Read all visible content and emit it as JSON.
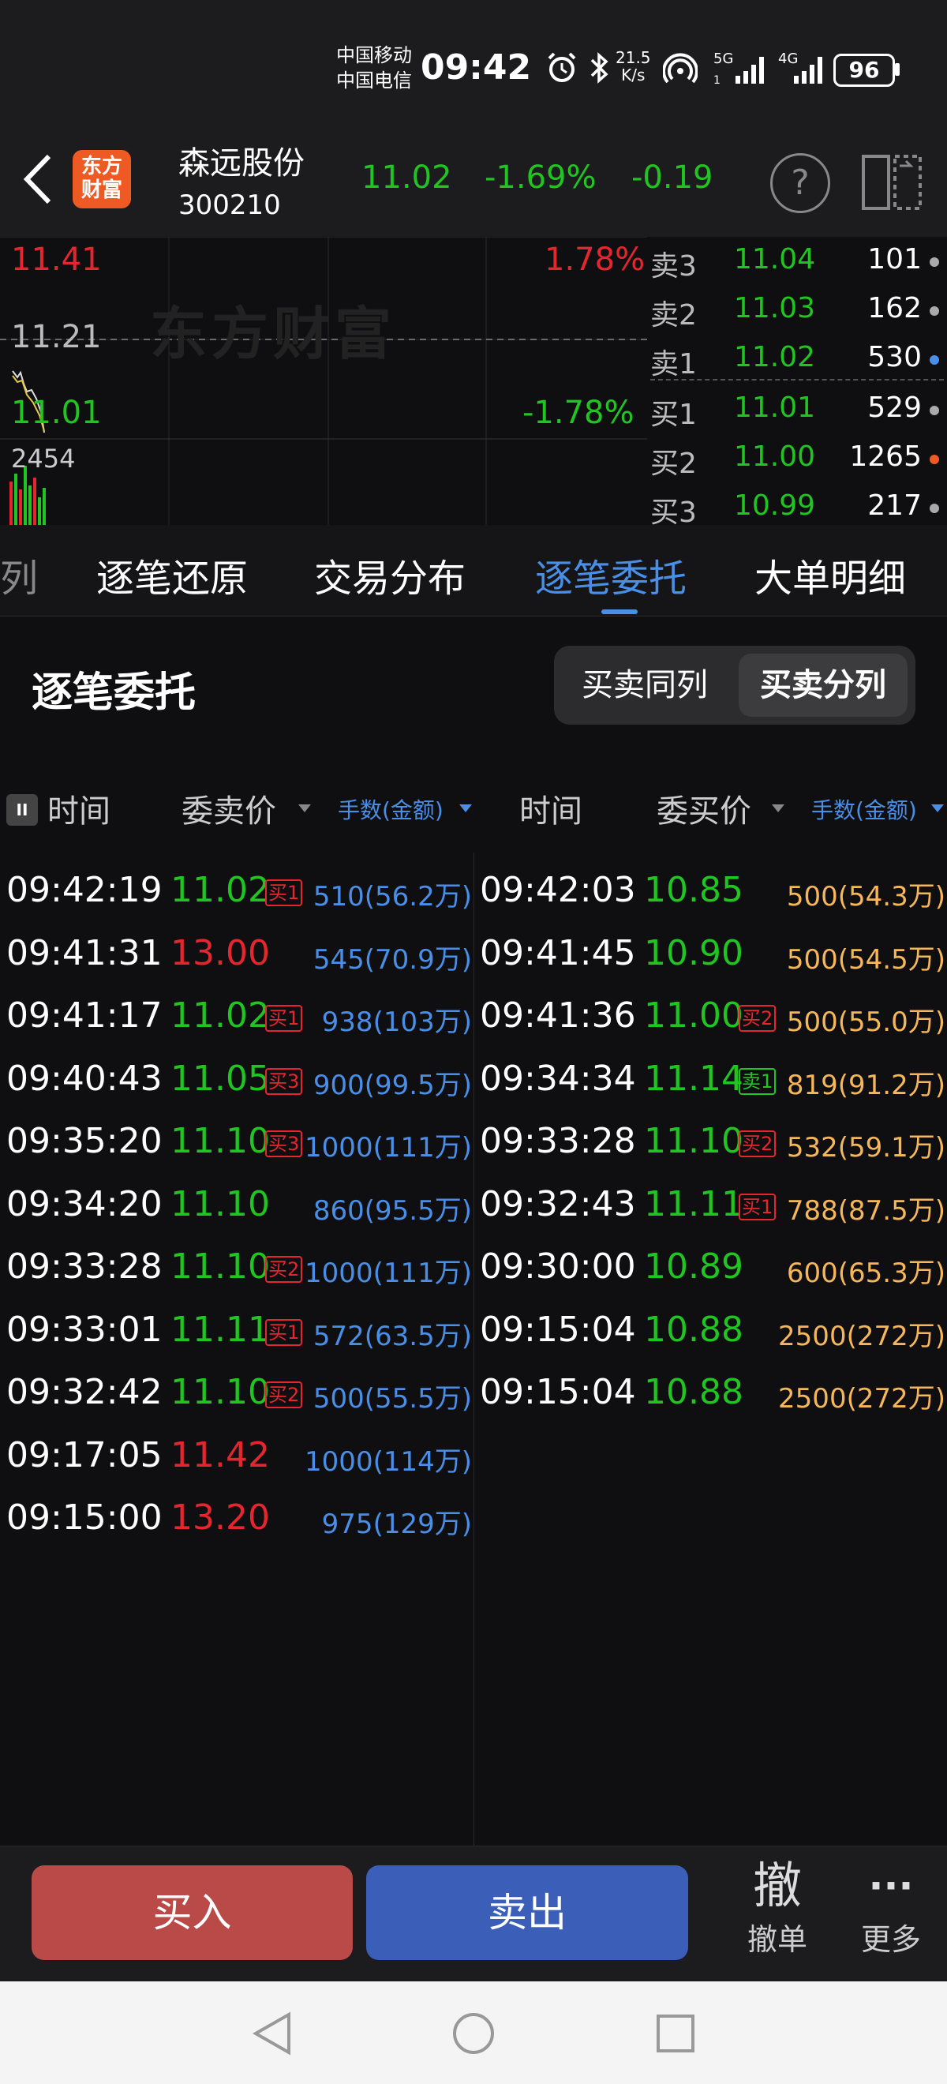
{
  "status_bar": {
    "carrier1": "中国移动",
    "carrier2": "中国电信",
    "time": "09:42",
    "speed_value": "21.5",
    "speed_unit": "K/s",
    "net1": "5G",
    "net2": "4G",
    "battery": "96"
  },
  "header": {
    "logo_text_line1": "东方",
    "logo_text_line2": "财富",
    "stock_name": "森远股份",
    "stock_code": "300210",
    "price": "11.02",
    "change_pct": "-1.69%",
    "change": "-0.19",
    "help_symbol": "?"
  },
  "chart": {
    "high_price": "11.41",
    "high_pct": "1.78%",
    "mid_price": "11.21",
    "low_price": "11.01",
    "low_pct": "-1.78%",
    "volume": "2454",
    "watermark": "东方财富"
  },
  "order_book": {
    "asks": [
      {
        "label": "卖3",
        "price": "11.04",
        "vol": "101",
        "dot": "#aaaaaa"
      },
      {
        "label": "卖2",
        "price": "11.03",
        "vol": "162",
        "dot": "#aaaaaa"
      },
      {
        "label": "卖1",
        "price": "11.02",
        "vol": "530",
        "dot": "#4a8fe7"
      }
    ],
    "bids": [
      {
        "label": "买1",
        "price": "11.01",
        "vol": "529",
        "dot": "#aaaaaa"
      },
      {
        "label": "买2",
        "price": "11.00",
        "vol": "1265",
        "dot": "#ee5a24"
      },
      {
        "label": "买3",
        "price": "10.99",
        "vol": "217",
        "dot": "#aaaaaa"
      }
    ]
  },
  "tabs": [
    {
      "label": "列"
    },
    {
      "label": "逐笔还原"
    },
    {
      "label": "交易分布"
    },
    {
      "label": "逐笔委托"
    },
    {
      "label": "大单明细"
    }
  ],
  "section": {
    "title": "逐笔委托",
    "toggle_same": "买卖同列",
    "toggle_split": "买卖分列"
  },
  "table_headers": {
    "pause_icon": "II",
    "time_left": "时间",
    "ask_price": "委卖价",
    "volume_left": "手数(金额)",
    "time_right": "时间",
    "bid_price": "委买价",
    "volume_right": "手数(金额)"
  },
  "sell_orders": [
    {
      "time": "09:42:19",
      "price": "11.02",
      "color": "green",
      "tag": "买1",
      "vol": "510(56.2万)"
    },
    {
      "time": "09:41:31",
      "price": "13.00",
      "color": "red",
      "tag": "",
      "vol": "545(70.9万)"
    },
    {
      "time": "09:41:17",
      "price": "11.02",
      "color": "green",
      "tag": "买1",
      "vol": "938(103万)"
    },
    {
      "time": "09:40:43",
      "price": "11.05",
      "color": "green",
      "tag": "买3",
      "vol": "900(99.5万)"
    },
    {
      "time": "09:35:20",
      "price": "11.10",
      "color": "green",
      "tag": "买3",
      "vol": "1000(111万)"
    },
    {
      "time": "09:34:20",
      "price": "11.10",
      "color": "green",
      "tag": "",
      "vol": "860(95.5万)"
    },
    {
      "time": "09:33:28",
      "price": "11.10",
      "color": "green",
      "tag": "买2",
      "vol": "1000(111万)"
    },
    {
      "time": "09:33:01",
      "price": "11.11",
      "color": "green",
      "tag": "买1",
      "vol": "572(63.5万)"
    },
    {
      "time": "09:32:42",
      "price": "11.10",
      "color": "green",
      "tag": "买2",
      "vol": "500(55.5万)"
    },
    {
      "time": "09:17:05",
      "price": "11.42",
      "color": "red",
      "tag": "",
      "vol": "1000(114万)"
    },
    {
      "time": "09:15:00",
      "price": "13.20",
      "color": "red",
      "tag": "",
      "vol": "975(129万)"
    }
  ],
  "buy_orders": [
    {
      "time": "09:42:03",
      "price": "10.85",
      "tag": "",
      "tag_type": "",
      "vol": "500(54.3万)"
    },
    {
      "time": "09:41:45",
      "price": "10.90",
      "tag": "",
      "tag_type": "",
      "vol": "500(54.5万)"
    },
    {
      "time": "09:41:36",
      "price": "11.00",
      "tag": "买2",
      "tag_type": "buy",
      "vol": "500(55.0万)"
    },
    {
      "time": "09:34:34",
      "price": "11.14",
      "tag": "卖1",
      "tag_type": "sell",
      "vol": "819(91.2万)"
    },
    {
      "time": "09:33:28",
      "price": "11.10",
      "tag": "买2",
      "tag_type": "buy",
      "vol": "532(59.1万)"
    },
    {
      "time": "09:32:43",
      "price": "11.11",
      "tag": "买1",
      "tag_type": "buy",
      "vol": "788(87.5万)"
    },
    {
      "time": "09:30:00",
      "price": "10.89",
      "tag": "",
      "tag_type": "",
      "vol": "600(65.3万)"
    },
    {
      "time": "09:15:04",
      "price": "10.88",
      "tag": "",
      "tag_type": "",
      "vol": "2500(272万)"
    },
    {
      "time": "09:15:04",
      "price": "10.88",
      "tag": "",
      "tag_type": "",
      "vol": "2500(272万)"
    }
  ],
  "bottom_bar": {
    "buy": "买入",
    "sell": "卖出",
    "cancel_icon": "撤",
    "cancel": "撤单",
    "more_icon": "···",
    "more": "更多"
  },
  "colors": {
    "green": "#21c521",
    "red": "#e6262e",
    "blue": "#4a8fe7",
    "orange": "#f5b75a"
  }
}
